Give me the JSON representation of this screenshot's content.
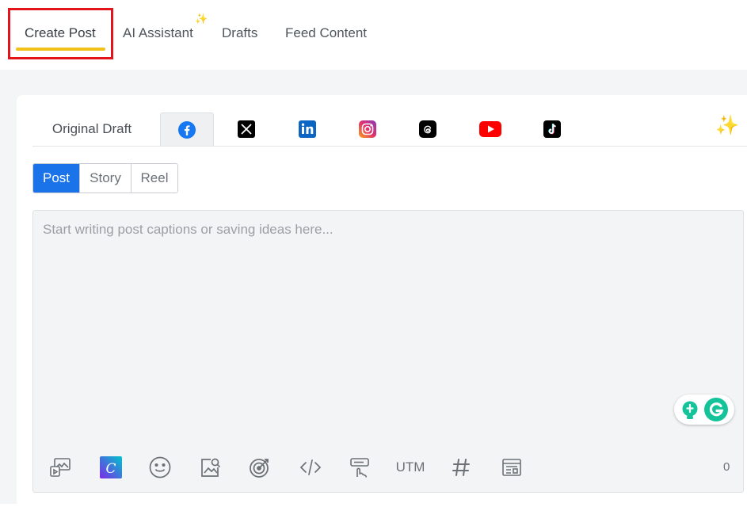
{
  "top_tabs": [
    {
      "label": "Create Post"
    },
    {
      "label": "AI Assistant"
    },
    {
      "label": "Drafts"
    },
    {
      "label": "Feed Content"
    }
  ],
  "network_tabs": {
    "original_label": "Original Draft",
    "networks": [
      {
        "icon": "facebook-icon",
        "color": "#1877f2"
      },
      {
        "icon": "x-icon",
        "color": "#000000"
      },
      {
        "icon": "linkedin-icon",
        "color": "#0a66c2"
      },
      {
        "icon": "instagram-icon",
        "color": "#e1306c"
      },
      {
        "icon": "threads-icon",
        "color": "#000000"
      },
      {
        "icon": "youtube-icon",
        "color": "#ff0000"
      },
      {
        "icon": "tiktok-icon",
        "color": "#000000"
      }
    ]
  },
  "post_types": [
    {
      "label": "Post",
      "active": true
    },
    {
      "label": "Story",
      "active": false
    },
    {
      "label": "Reel",
      "active": false
    }
  ],
  "editor": {
    "placeholder": "Start writing post captions or saving ideas here...",
    "value": ""
  },
  "toolbar": {
    "utm_label": "UTM",
    "char_count": "0",
    "icons": [
      "media-icon",
      "canva-icon",
      "emoji-icon",
      "image-search-icon",
      "target-icon",
      "code-icon",
      "cta-icon",
      "utm-label",
      "hashtag-icon",
      "template-icon"
    ]
  },
  "colors": {
    "accent": "#1a73e8",
    "highlight_border": "#e3151b",
    "tab_underline": "#f2c21b",
    "grammarly": "#15c39a"
  }
}
